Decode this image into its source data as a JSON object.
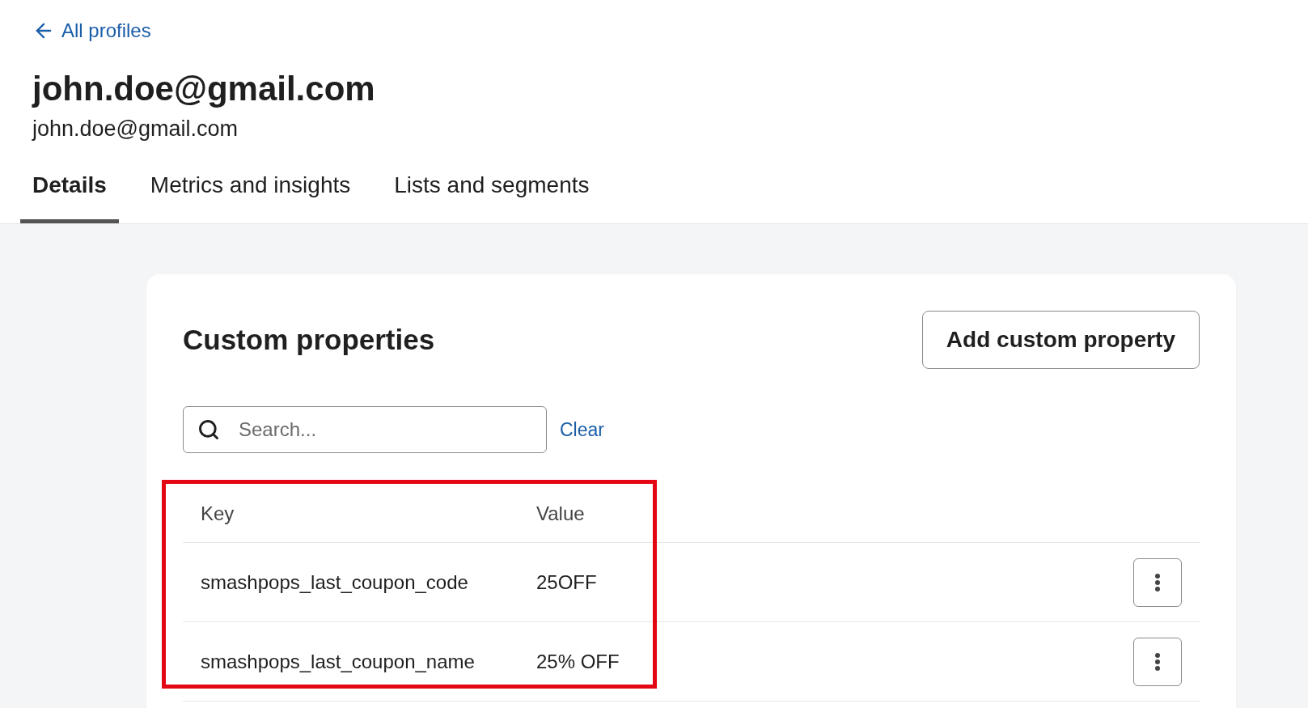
{
  "back_link": {
    "label": "All profiles"
  },
  "profile": {
    "title": "john.doe@gmail.com",
    "subtitle": "john.doe@gmail.com"
  },
  "tabs": [
    {
      "label": "Details",
      "selected": true
    },
    {
      "label": "Metrics and insights",
      "selected": false
    },
    {
      "label": "Lists and segments",
      "selected": false
    }
  ],
  "card": {
    "title": "Custom properties",
    "action_button": "Add custom property",
    "search": {
      "placeholder": "Search..."
    },
    "clear_link": "Clear",
    "table": {
      "columns": [
        "Key",
        "Value"
      ],
      "rows": [
        {
          "key": "smashpops_last_coupon_code",
          "value": "25OFF"
        },
        {
          "key": "smashpops_last_coupon_name",
          "value": "25% OFF"
        }
      ]
    }
  },
  "annotation": {
    "kind": "highlight-rectangle",
    "color": "#e30613"
  }
}
